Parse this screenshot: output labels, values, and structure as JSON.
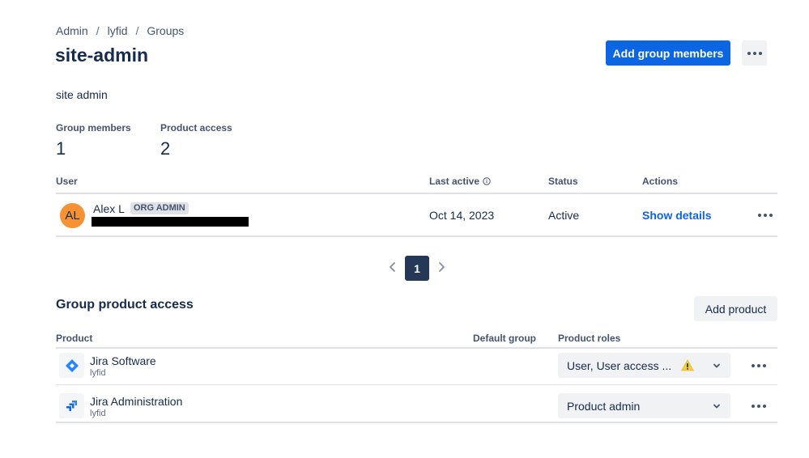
{
  "breadcrumb": {
    "items": [
      "Admin",
      "lyfid",
      "Groups"
    ],
    "separator": "/"
  },
  "page": {
    "title": "site-admin",
    "description": "site admin"
  },
  "header_actions": {
    "add_members_label": "Add group members"
  },
  "stats": [
    {
      "label": "Group members",
      "value": "1"
    },
    {
      "label": "Product access",
      "value": "2"
    }
  ],
  "members_table": {
    "columns": {
      "user": "User",
      "last_active": "Last active",
      "status": "Status",
      "actions": "Actions"
    },
    "rows": [
      {
        "avatar_initials": "AL",
        "name": "Alex L",
        "badge": "ORG ADMIN",
        "last_active": "Oct 14, 2023",
        "status": "Active",
        "action_label": "Show details"
      }
    ]
  },
  "pagination": {
    "current_page": "1"
  },
  "product_access": {
    "title": "Group product access",
    "add_product_label": "Add product",
    "columns": {
      "product": "Product",
      "default_group": "Default group",
      "product_roles": "Product roles"
    },
    "rows": [
      {
        "icon": "jira-software-icon",
        "name": "Jira Software",
        "site": "lyfid",
        "roles": "User, User access ...",
        "warning": true
      },
      {
        "icon": "jira-administration-icon",
        "name": "Jira Administration",
        "site": "lyfid",
        "roles": "Product admin",
        "warning": false
      }
    ]
  },
  "colors": {
    "primary": "#0C66E4",
    "avatar": "#F79232",
    "page_active": "#253858",
    "warning": "#F5CD47"
  }
}
